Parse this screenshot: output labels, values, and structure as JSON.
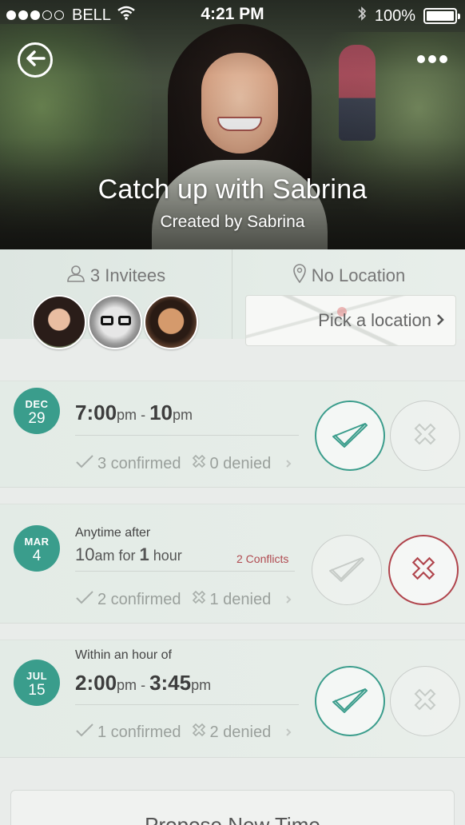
{
  "status_bar": {
    "carrier": "BELL",
    "time": "4:21 PM",
    "battery": "100%"
  },
  "header": {
    "title": "Catch up with Sabrina",
    "subtitle": "Created by Sabrina"
  },
  "invitees": {
    "label": "3 Invitees",
    "avatars": [
      "Sabrina",
      "Invitee 2",
      "Invitee 3"
    ]
  },
  "location": {
    "label": "No Location",
    "pick_label": "Pick a location"
  },
  "options": [
    {
      "month": "DEC",
      "day": "29",
      "pre": "",
      "time": {
        "start_big": "7:00",
        "start_small": "pm",
        "sep": " - ",
        "end_big": "10",
        "end_small": "pm"
      },
      "conflicts": "",
      "confirmed": "3 confirmed",
      "denied": "0 denied",
      "response": "accepted"
    },
    {
      "month": "MAR",
      "day": "4",
      "pre": "Anytime after",
      "time": {
        "start_big": "10",
        "start_small": "am for ",
        "end_big": "1",
        "end_small": " hour"
      },
      "conflicts": "2 Conflicts",
      "confirmed": "2 confirmed",
      "denied": "1 denied",
      "response": "denied"
    },
    {
      "month": "JUL",
      "day": "15",
      "pre": "Within an hour of",
      "time": {
        "start_big": "2:00",
        "start_small": "pm",
        "sep": " - ",
        "end_big": "3:45",
        "end_small": "pm"
      },
      "conflicts": "",
      "confirmed": "1 confirmed",
      "denied": "2 denied",
      "response": "accepted"
    }
  ],
  "propose_button": "Propose New Time",
  "colors": {
    "accent_green": "#3a9d8c",
    "deny_red": "#b0444c"
  }
}
